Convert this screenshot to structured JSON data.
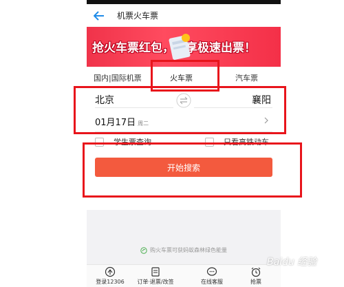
{
  "nav": {
    "title": "机票火车票"
  },
  "banner": {
    "text": "抢火车票红包，乐享极速出票！"
  },
  "tabs": [
    {
      "label": "国内|国际机票"
    },
    {
      "label": "火车票"
    },
    {
      "label": "汽车票"
    }
  ],
  "form": {
    "from_city": "北京",
    "to_city": "襄阳",
    "date": "01月17日",
    "weekday": "周二",
    "student_option": "学生票查询",
    "highspeed_option": "只看高铁动车",
    "search_button": "开始搜索"
  },
  "hint": "购火车票可获蚂蚁森林绿色能量",
  "bottom": [
    {
      "label": "登录12306"
    },
    {
      "label": "订单·退票/改签"
    },
    {
      "label": "在线客服"
    },
    {
      "label": "抢票"
    }
  ],
  "watermark": "Baidu 经验",
  "colors": {
    "accent": "#f35a3e",
    "highlight": "#e8141b",
    "banner": "#f0334a"
  }
}
